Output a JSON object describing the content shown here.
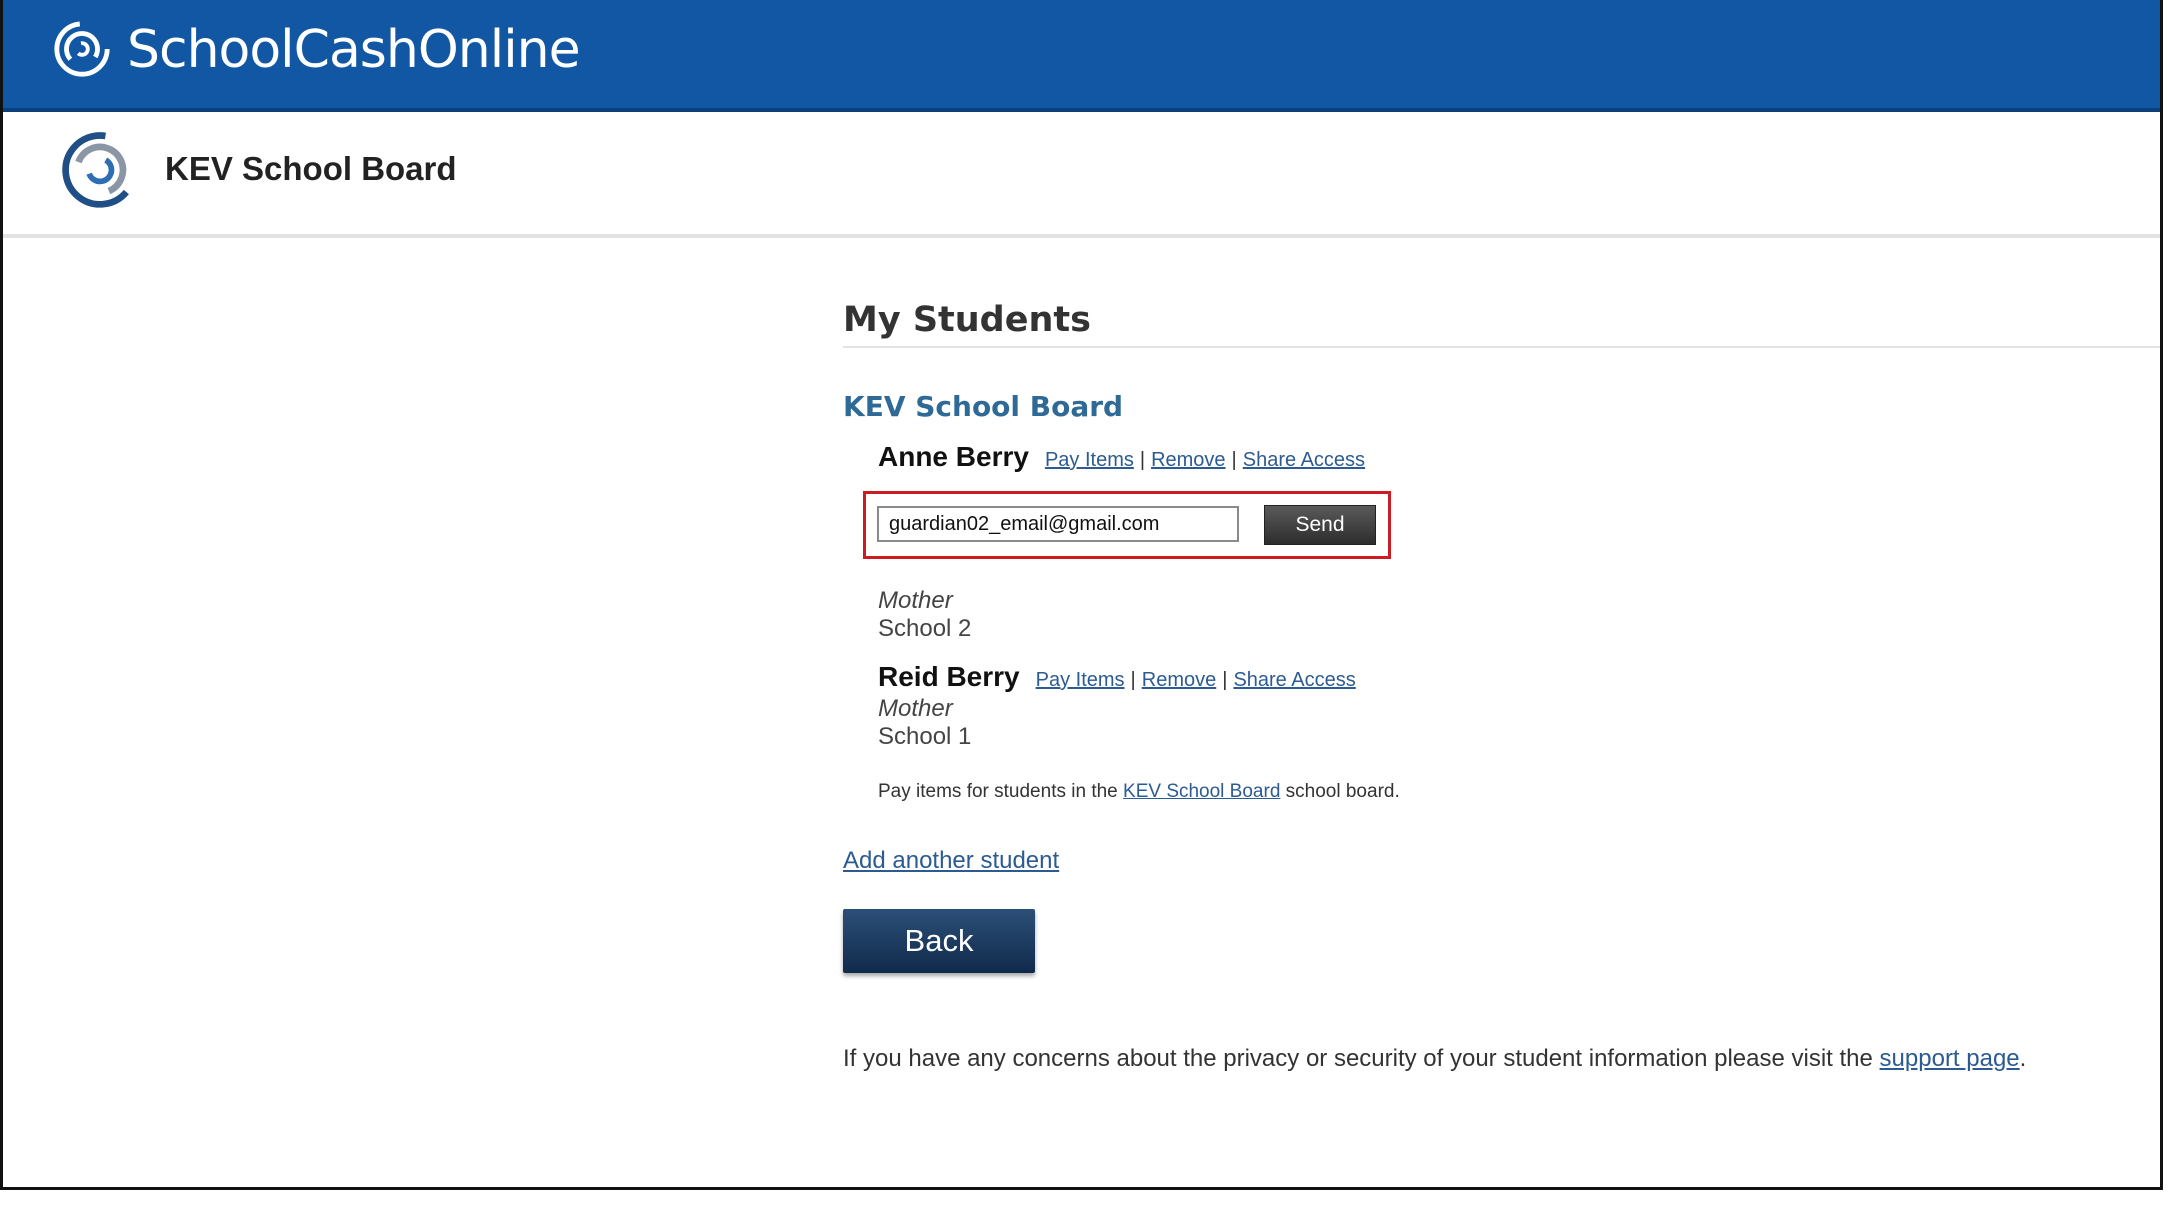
{
  "header": {
    "brand": "SchoolCashOnline",
    "logo_icon": "swirl-logo-icon"
  },
  "org_bar": {
    "name": "KEV School Board",
    "logo_icon": "school-board-logo-icon"
  },
  "main": {
    "title": "My Students",
    "board_title": "KEV School Board",
    "students": [
      {
        "name": "Anne Berry",
        "links": {
          "pay": "Pay Items",
          "remove": "Remove",
          "share": "Share Access"
        },
        "sep": "|",
        "relation": "Mother",
        "school": "School 2",
        "share_email": "guardian02_email@gmail.com",
        "send_label": "Send"
      },
      {
        "name": "Reid Berry",
        "links": {
          "pay": "Pay Items",
          "remove": "Remove",
          "share": "Share Access"
        },
        "sep": "|",
        "relation": "Mother",
        "school": "School 1"
      }
    ],
    "note": {
      "pre": "Pay items for students in the ",
      "link": "KEV School Board",
      "post": " school board."
    },
    "add_student": "Add another student",
    "back_label": "Back",
    "privacy": {
      "pre": "If you have any concerns about the privacy or security of your student information please visit the ",
      "link": "support page",
      "post": "."
    }
  },
  "colors": {
    "header_bg": "#1257a3",
    "link": "#2c5b93",
    "board_title": "#2e6a95",
    "highlight_border": "#cc1b22",
    "back_button": "#1b3a63"
  }
}
